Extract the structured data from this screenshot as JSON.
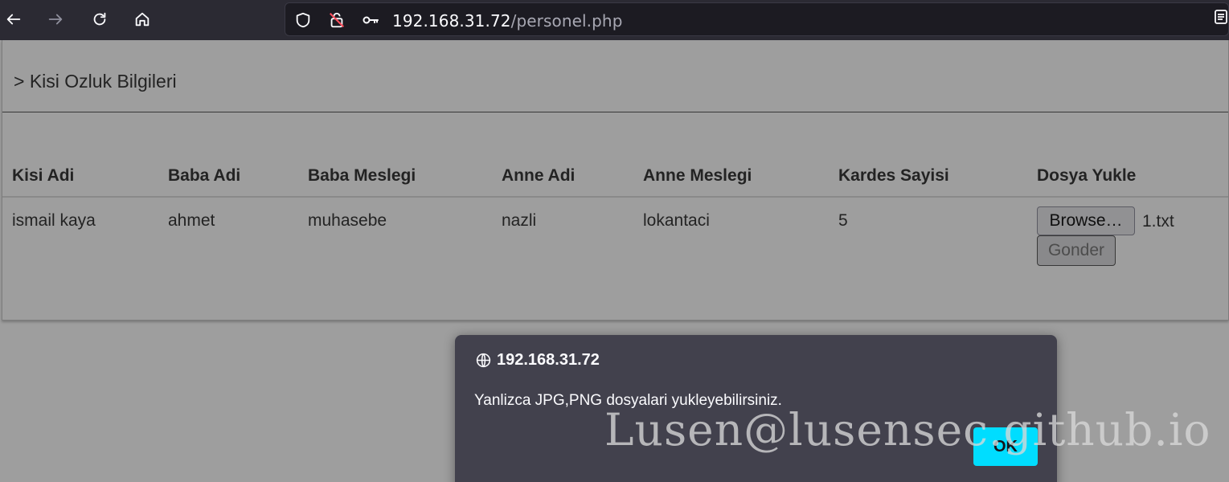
{
  "browser": {
    "url_host": "192.168.31.72",
    "url_path": "/personel.php"
  },
  "panel": {
    "title": "> Kisi Ozluk Bilgileri"
  },
  "table": {
    "headers": [
      "Kisi Adi",
      "Baba Adi",
      "Baba Meslegi",
      "Anne Adi",
      "Anne Meslegi",
      "Kardes Sayisi",
      "Dosya Yukle"
    ],
    "row": {
      "kisi_adi": "ismail kaya",
      "baba_adi": "ahmet",
      "baba_meslegi": "muhasebe",
      "anne_adi": "nazli",
      "anne_meslegi": "lokantaci",
      "kardes_sayisi": "5"
    },
    "file_button": "Browse…",
    "file_name": "1.txt",
    "submit_button": "Gonder"
  },
  "dialog": {
    "origin": "192.168.31.72",
    "message": "Yanlizca JPG,PNG dosyalari yukleyebilirsiniz.",
    "ok_label": "OK"
  },
  "watermark": "Lusen@lusensec.github.io",
  "colors": {
    "toolbar_bg": "#2b2a33",
    "dialog_bg": "#42414d",
    "ok_button": "#00ddff"
  }
}
